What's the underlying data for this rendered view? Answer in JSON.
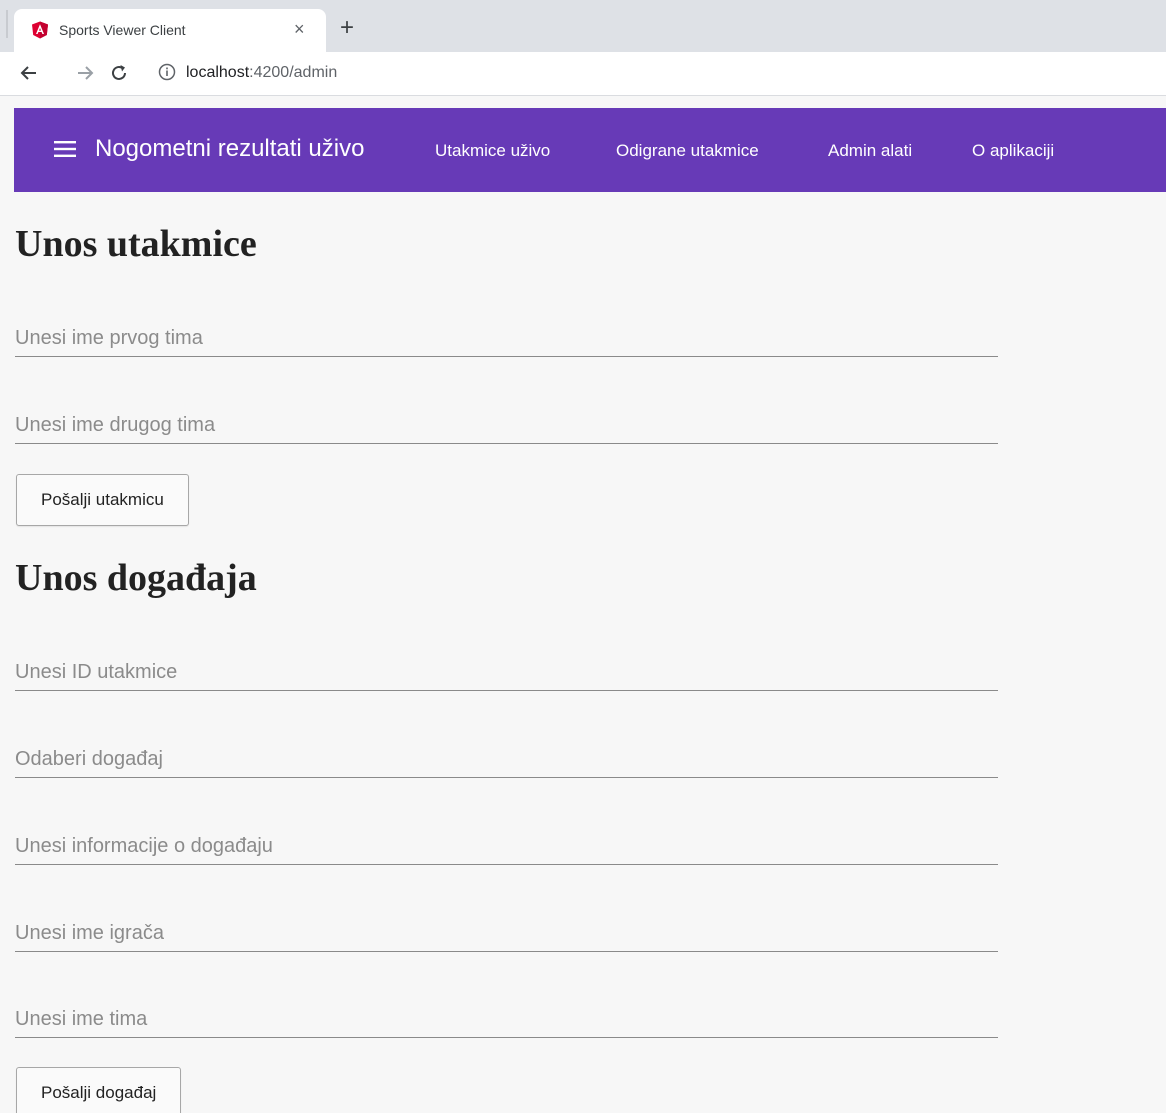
{
  "browser": {
    "tab_title": "Sports Viewer Client",
    "tab_close": "×",
    "new_tab": "+",
    "address_host": "localhost",
    "address_path": ":4200/admin"
  },
  "app_bar": {
    "title": "Nogometni rezultati uživo",
    "nav": [
      {
        "label": "Utakmice uživo"
      },
      {
        "label": "Odigrane utakmice"
      },
      {
        "label": "Admin alati"
      },
      {
        "label": "O aplikaciji"
      }
    ]
  },
  "match_form": {
    "heading": "Unos utakmice",
    "fields": [
      {
        "placeholder": "Unesi ime prvog tima",
        "value": ""
      },
      {
        "placeholder": "Unesi ime drugog tima",
        "value": ""
      }
    ],
    "submit_label": "Pošalji utakmicu"
  },
  "event_form": {
    "heading": "Unos događaja",
    "fields": [
      {
        "placeholder": "Unesi ID utakmice",
        "value": ""
      },
      {
        "placeholder": "Odaberi događaj",
        "value": ""
      },
      {
        "placeholder": "Unesi informacije o događaju",
        "value": ""
      },
      {
        "placeholder": "Unesi ime igrača",
        "value": ""
      },
      {
        "placeholder": "Unesi ime tima",
        "value": ""
      }
    ],
    "submit_label": "Pošalji događaj"
  },
  "colors": {
    "app_bar": "#673ab7",
    "page_background": "#f7f7f7",
    "angular_red": "#dd0031"
  }
}
